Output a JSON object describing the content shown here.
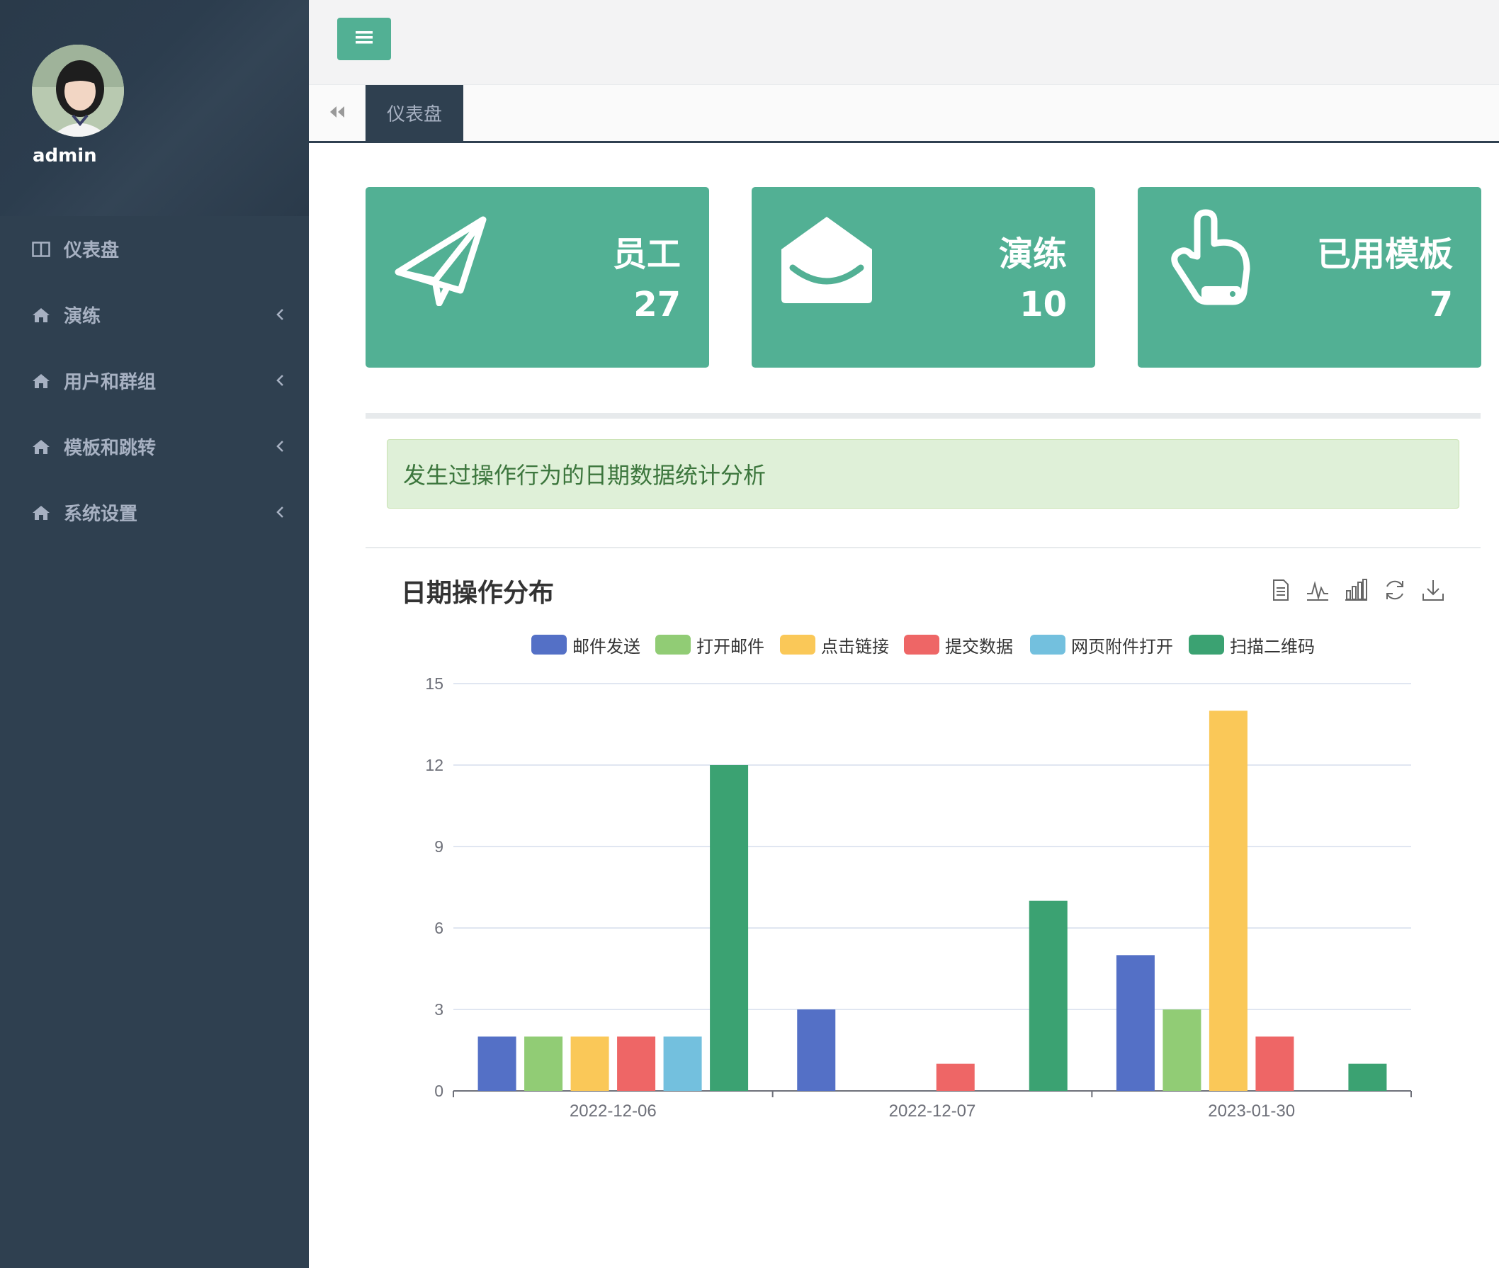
{
  "sidebar": {
    "profile_name": "admin",
    "items": [
      {
        "label": "仪表盘",
        "icon": "columns-icon",
        "has_arrow": false
      },
      {
        "label": "演练",
        "icon": "home-icon",
        "has_arrow": true
      },
      {
        "label": "用户和群组",
        "icon": "home-icon",
        "has_arrow": true
      },
      {
        "label": "模板和跳转",
        "icon": "home-icon",
        "has_arrow": true
      },
      {
        "label": "系统设置",
        "icon": "home-icon",
        "has_arrow": true
      }
    ]
  },
  "topbar": {
    "menu_icon": "bars-icon"
  },
  "tabs": {
    "back_icon": "double-left-icon",
    "active": "仪表盘"
  },
  "cards": [
    {
      "title": "员工",
      "value": "27",
      "icon": "paper-plane-icon"
    },
    {
      "title": "演练",
      "value": "10",
      "icon": "envelope-open-icon"
    },
    {
      "title": "已用模板",
      "value": "7",
      "icon": "hand-pointer-icon"
    }
  ],
  "alert": {
    "text": "发生过操作行为的日期数据统计分析"
  },
  "chart_title": "日期操作分布",
  "toolbox": [
    "data-view-icon",
    "line-chart-icon",
    "bar-chart-icon",
    "refresh-icon",
    "download-icon"
  ],
  "colors": {
    "sidebar": "#2f4050",
    "accent": "#52b094",
    "alert_bg": "#dff0d8",
    "alert_text": "#3c763d"
  },
  "chart_data": {
    "type": "bar",
    "categories": [
      "2022-12-06",
      "2022-12-07",
      "2023-01-30"
    ],
    "series": [
      {
        "name": "邮件发送",
        "color": "#5470c6",
        "values": [
          2,
          3,
          5
        ]
      },
      {
        "name": "打开邮件",
        "color": "#91cc75",
        "values": [
          2,
          0,
          3
        ]
      },
      {
        "name": "点击链接",
        "color": "#fac858",
        "values": [
          2,
          0,
          14
        ]
      },
      {
        "name": "提交数据",
        "color": "#ee6666",
        "values": [
          2,
          1,
          2
        ]
      },
      {
        "name": "网页附件打开",
        "color": "#73c0de",
        "values": [
          2,
          0,
          0
        ]
      },
      {
        "name": "扫描二维码",
        "color": "#3ba272",
        "values": [
          12,
          7,
          1
        ]
      }
    ],
    "yticks": [
      "0",
      "3",
      "6",
      "9",
      "12",
      "15"
    ],
    "ylim": [
      0,
      15
    ],
    "grid": true,
    "legend": "top-center"
  }
}
